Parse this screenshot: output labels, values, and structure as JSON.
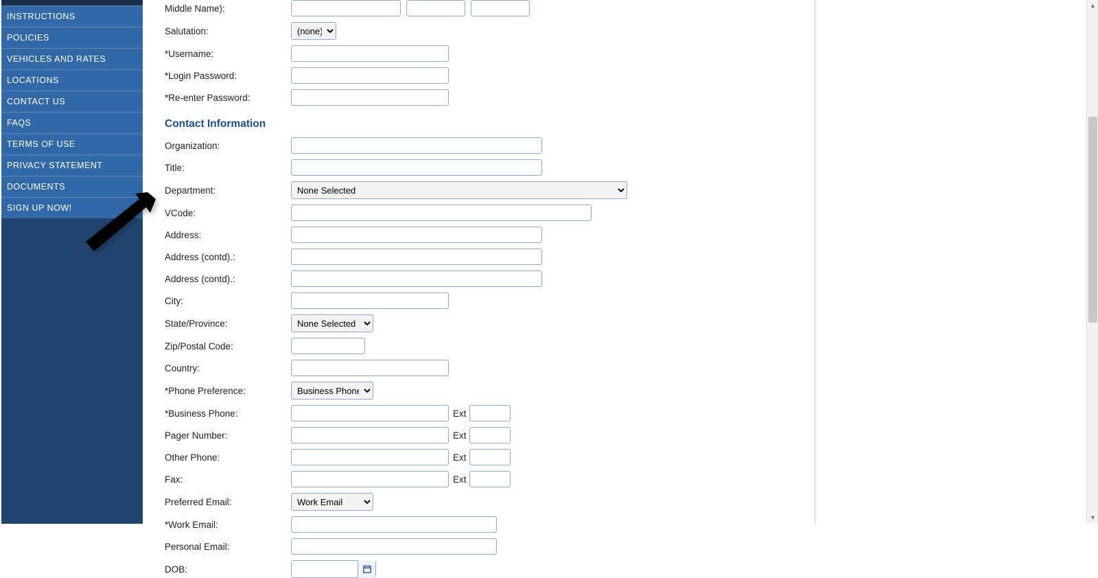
{
  "sidebar": {
    "items": [
      {
        "label": "INSTRUCTIONS"
      },
      {
        "label": "POLICIES"
      },
      {
        "label": "VEHICLES AND RATES"
      },
      {
        "label": "LOCATIONS"
      },
      {
        "label": "CONTACT US"
      },
      {
        "label": "FAQS"
      },
      {
        "label": "TERMS OF USE"
      },
      {
        "label": "PRIVACY STATEMENT"
      },
      {
        "label": "DOCUMENTS"
      },
      {
        "label": "SIGN UP NOW!"
      }
    ]
  },
  "form": {
    "identity": {
      "name_label": "Middle Name):",
      "salutation_label": "Salutation:",
      "salutation_value": "(none)",
      "username_label": "*Username:",
      "password_label": "*Login Password:",
      "repassword_label": "*Re-enter Password:"
    },
    "contact": {
      "section_title": "Contact Information",
      "organization_label": "Organization:",
      "title_label": "Title:",
      "department_label": "Department:",
      "department_value": "None Selected",
      "vcode_label": "VCode:",
      "address_label": "Address:",
      "address_contd1_label": "Address (contd).:",
      "address_contd2_label": "Address (contd).:",
      "city_label": "City:",
      "state_label": "State/Province:",
      "state_value": "None Selected",
      "zip_label": "Zip/Postal Code:",
      "country_label": "Country:",
      "phone_pref_label": "*Phone Preference:",
      "phone_pref_value": "Business Phone",
      "business_phone_label": "*Business Phone:",
      "pager_label": "Pager Number:",
      "other_phone_label": "Other Phone:",
      "fax_label": "Fax:",
      "ext_label": "Ext",
      "pref_email_label": "Preferred Email:",
      "pref_email_value": "Work Email",
      "work_email_label": "*Work Email:",
      "personal_email_label": "Personal Email:",
      "dob_label": "DOB:"
    }
  }
}
